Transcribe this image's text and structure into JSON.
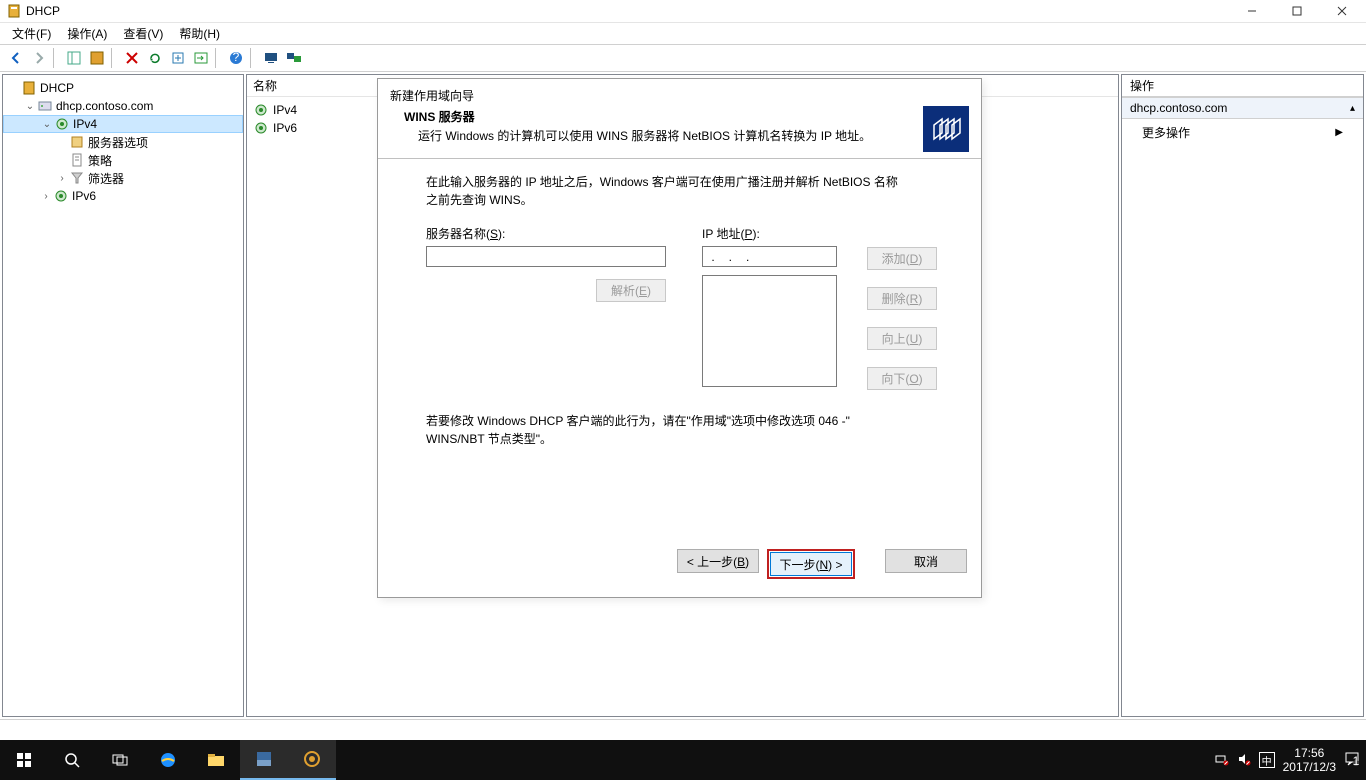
{
  "window": {
    "title": "DHCP"
  },
  "menu": {
    "file": "文件(F)",
    "action": "操作(A)",
    "view": "查看(V)",
    "help": "帮助(H)"
  },
  "tree": {
    "root": "DHCP",
    "server": "dhcp.contoso.com",
    "ipv4": "IPv4",
    "server_options": "服务器选项",
    "policy": "策略",
    "filters": "筛选器",
    "ipv6": "IPv6"
  },
  "center": {
    "header": "名称",
    "items": [
      "IPv4",
      "IPv6"
    ]
  },
  "actions": {
    "header": "操作",
    "group": "dhcp.contoso.com",
    "more": "更多操作"
  },
  "wizard": {
    "title": "新建作用域向导",
    "heading": "WINS 服务器",
    "subheading": "运行 Windows 的计算机可以使用 WINS 服务器将 NetBIOS 计算机名转换为 IP 地址。",
    "instr1": "在此输入服务器的 IP 地址之后，Windows 客户端可在使用广播注册并解析 NetBIOS 名称之前先查询 WINS。",
    "server_name_label": "服务器名称(S):",
    "ip_label": "IP 地址(P):",
    "resolve": "解析(E)",
    "add": "添加(D)",
    "remove": "删除(R)",
    "up": "向上(U)",
    "down": "向下(O)",
    "note": "若要修改 Windows DHCP 客户端的此行为，请在\"作用域\"选项中修改选项 046 -\" WINS/NBT 节点类型\"。",
    "back": "< 上一步(B)",
    "next": "下一步(N) >",
    "cancel": "取消",
    "ip_value": "",
    "server_value": ""
  },
  "taskbar": {
    "ime": "中",
    "time": "17:56",
    "date": "2017/12/3"
  }
}
